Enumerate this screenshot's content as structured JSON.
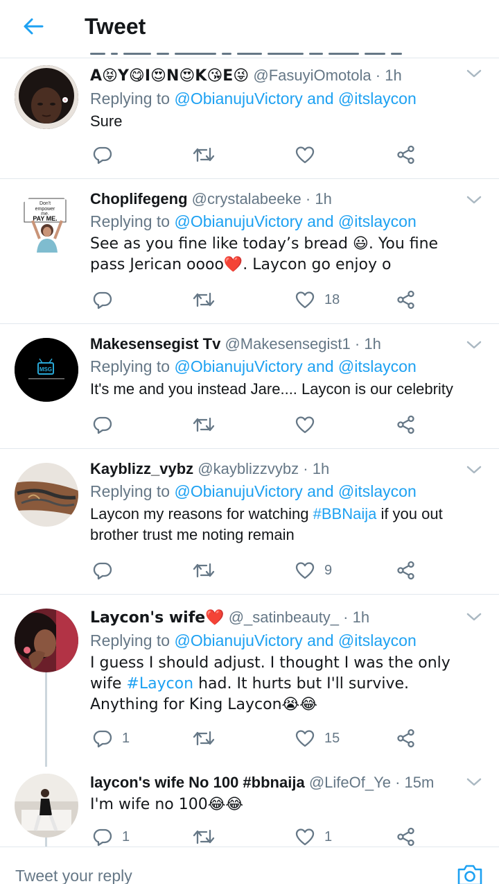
{
  "header": {
    "title": "Tweet"
  },
  "tweets": [
    {
      "name": "A😝Y😋I😍N😍K😘E😜",
      "handle": "@FasuyiOmotola",
      "time": "1h",
      "replying_prefix": "Replying to",
      "reply_to_1": "@ObianujuVictory",
      "reply_and": "and",
      "reply_to_2": "@itslaycon",
      "text": "Sure",
      "reply_count": "",
      "like_count": ""
    },
    {
      "name": "Choplifegeng",
      "handle": "@crystalabeeke",
      "time": "1h",
      "replying_prefix": "Replying to",
      "reply_to_1": "@ObianujuVictory",
      "reply_and": "and",
      "reply_to_2": "@itslaycon",
      "text": "See as you fine like today’s bread 😃. You fine pass Jerican oooo❤️. Laycon go enjoy o",
      "reply_count": "",
      "like_count": "18",
      "avatar_sign": [
        "Don't",
        "empower",
        "me.",
        "PAY ME."
      ]
    },
    {
      "name": "Makesensegist Tv",
      "handle": "@Makesensegist1",
      "time": "1h",
      "replying_prefix": "Replying to",
      "reply_to_1": "@ObianujuVictory",
      "reply_and": "and",
      "reply_to_2": "@itslaycon",
      "text": "It's me and you instead Jare.... Laycon is our celebrity",
      "reply_count": "",
      "like_count": "",
      "avatar_logo": "MSG"
    },
    {
      "name": "Kayblizz_vybz",
      "handle": "@kayblizzvybz",
      "time": "1h",
      "replying_prefix": "Replying to",
      "reply_to_1": "@ObianujuVictory",
      "reply_and": "and",
      "reply_to_2": "@itslaycon",
      "text_before": "Laycon my reasons for watching ",
      "text_tag": "#BBNaija",
      "text_after": " if you out brother trust me noting remain",
      "reply_count": "",
      "like_count": "9"
    },
    {
      "name": "Laycon's wife❤️",
      "handle": "@_satinbeauty_",
      "time": "1h",
      "replying_prefix": "Replying to",
      "reply_to_1": "@ObianujuVictory",
      "reply_and": "and",
      "reply_to_2": "@itslaycon",
      "text_before": "I guess I should adjust. I thought I was the only wife ",
      "text_tag": "#Laycon",
      "text_after": " had. It hurts but I'll survive. Anything for King Laycon😭😂",
      "reply_count": "1",
      "like_count": "15"
    },
    {
      "name": "laycon's wife No 100 #bbnaija",
      "handle": "@LifeOf_Ye",
      "time": "15m",
      "text": "I'm wife no 100😂😂",
      "reply_count": "1",
      "like_count": "1"
    }
  ],
  "separator": "·",
  "reply_bar": {
    "placeholder": "Tweet your reply"
  },
  "colors": {
    "accent": "#1da1f2",
    "secondary_text": "#657786",
    "divider": "#e1e8ed"
  }
}
